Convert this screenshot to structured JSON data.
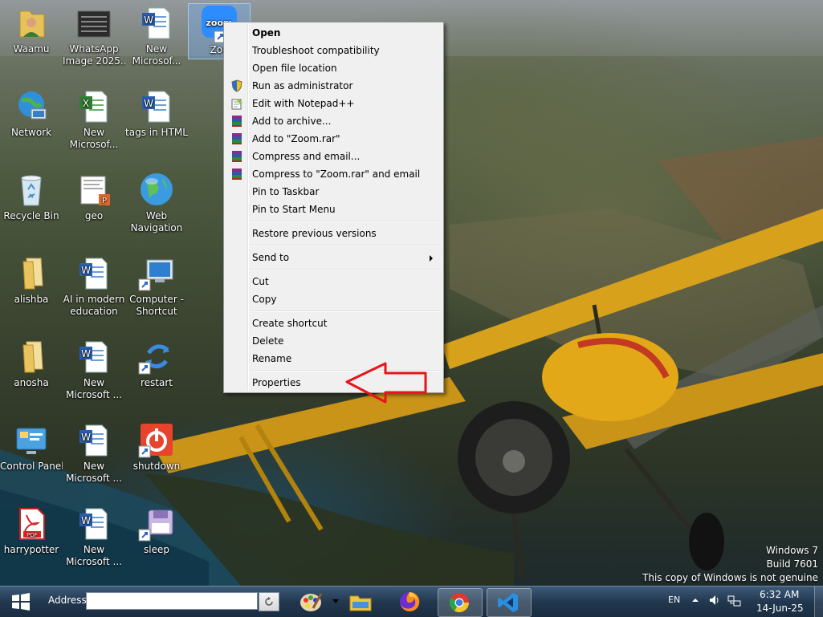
{
  "desktop": {
    "icons": [
      {
        "label": "Waamu",
        "icon": "user-folder-icon"
      },
      {
        "label": "WhatsApp Image 2025...",
        "line1": "WhatsApp",
        "line2": "Image 2025...",
        "icon": "image-file-icon"
      },
      {
        "line1": "New",
        "line2": "Microsof...",
        "icon": "word-document-icon"
      },
      {
        "label": "Zoom",
        "icon": "zoom-shortcut-icon"
      },
      {
        "label": "Network",
        "icon": "network-icon"
      },
      {
        "line1": "New",
        "line2": "Microsof...",
        "icon": "excel-document-icon"
      },
      {
        "label": "tags in HTML",
        "icon": "word-document-icon"
      },
      {
        "label": "Recycle Bin",
        "icon": "recycle-bin-icon"
      },
      {
        "label": "geo",
        "icon": "powerpoint-file-icon"
      },
      {
        "line1": "Web",
        "line2": "Navigation",
        "icon": "globe-icon"
      },
      {
        "label": "alishba",
        "icon": "folder-icon"
      },
      {
        "line1": "AI in modern",
        "line2": "education",
        "icon": "word-document-icon"
      },
      {
        "line1": "Computer -",
        "line2": "Shortcut",
        "icon": "computer-shortcut-icon"
      },
      {
        "label": "anosha",
        "icon": "folder-icon"
      },
      {
        "line1": "New",
        "line2": "Microsoft ...",
        "icon": "word-document-icon"
      },
      {
        "label": "restart",
        "icon": "restart-shortcut-icon"
      },
      {
        "label": "Control Panel",
        "icon": "control-panel-icon"
      },
      {
        "line1": "New",
        "line2": "Microsoft ...",
        "icon": "word-document-icon"
      },
      {
        "label": "shutdown",
        "icon": "shutdown-shortcut-icon"
      },
      {
        "label": "harrypotter",
        "icon": "pdf-file-icon"
      },
      {
        "line1": "New",
        "line2": "Microsoft ...",
        "icon": "word-document-icon"
      },
      {
        "label": "sleep",
        "icon": "sleep-shortcut-icon"
      }
    ],
    "zoom_label_partial": "Zoo"
  },
  "context_menu": {
    "items": [
      {
        "label": "Open",
        "bold": true
      },
      {
        "label": "Troubleshoot compatibility"
      },
      {
        "label": "Open file location"
      },
      {
        "label": "Run as administrator",
        "icon": "uac-shield-icon"
      },
      {
        "label": "Edit with Notepad++",
        "icon": "notepad-plus-plus-icon"
      },
      {
        "label": "Add to archive...",
        "icon": "winrar-icon"
      },
      {
        "label": "Add to \"Zoom.rar\"",
        "icon": "winrar-icon"
      },
      {
        "label": "Compress and email...",
        "icon": "winrar-icon"
      },
      {
        "label": "Compress to \"Zoom.rar\" and email",
        "icon": "winrar-icon"
      },
      {
        "label": "Pin to Taskbar"
      },
      {
        "label": "Pin to Start Menu"
      },
      {
        "label": "Restore previous versions"
      },
      {
        "label": "Send to",
        "submenu": true
      },
      {
        "label": "Cut"
      },
      {
        "label": "Copy"
      },
      {
        "label": "Create shortcut"
      },
      {
        "label": "Delete"
      },
      {
        "label": "Rename"
      },
      {
        "label": "Properties"
      }
    ]
  },
  "annotation": {
    "color": "#e8141b",
    "icon": "red-arrow-icon"
  },
  "watermark": {
    "line1": "Windows 7",
    "line2": "Build 7601",
    "line3": "This copy of Windows is not genuine"
  },
  "taskbar": {
    "address_label": "Address",
    "address_value": "",
    "pinned": [
      {
        "name": "paint",
        "icon": "paint-palette-icon"
      },
      {
        "name": "explorer",
        "icon": "file-explorer-icon"
      },
      {
        "name": "firefox",
        "icon": "firefox-icon"
      },
      {
        "name": "chrome",
        "icon": "chrome-icon"
      },
      {
        "name": "vscode",
        "icon": "vscode-icon"
      }
    ],
    "tray": {
      "language": "EN",
      "time": "6:32 AM",
      "date": "14-Jun-25"
    }
  }
}
